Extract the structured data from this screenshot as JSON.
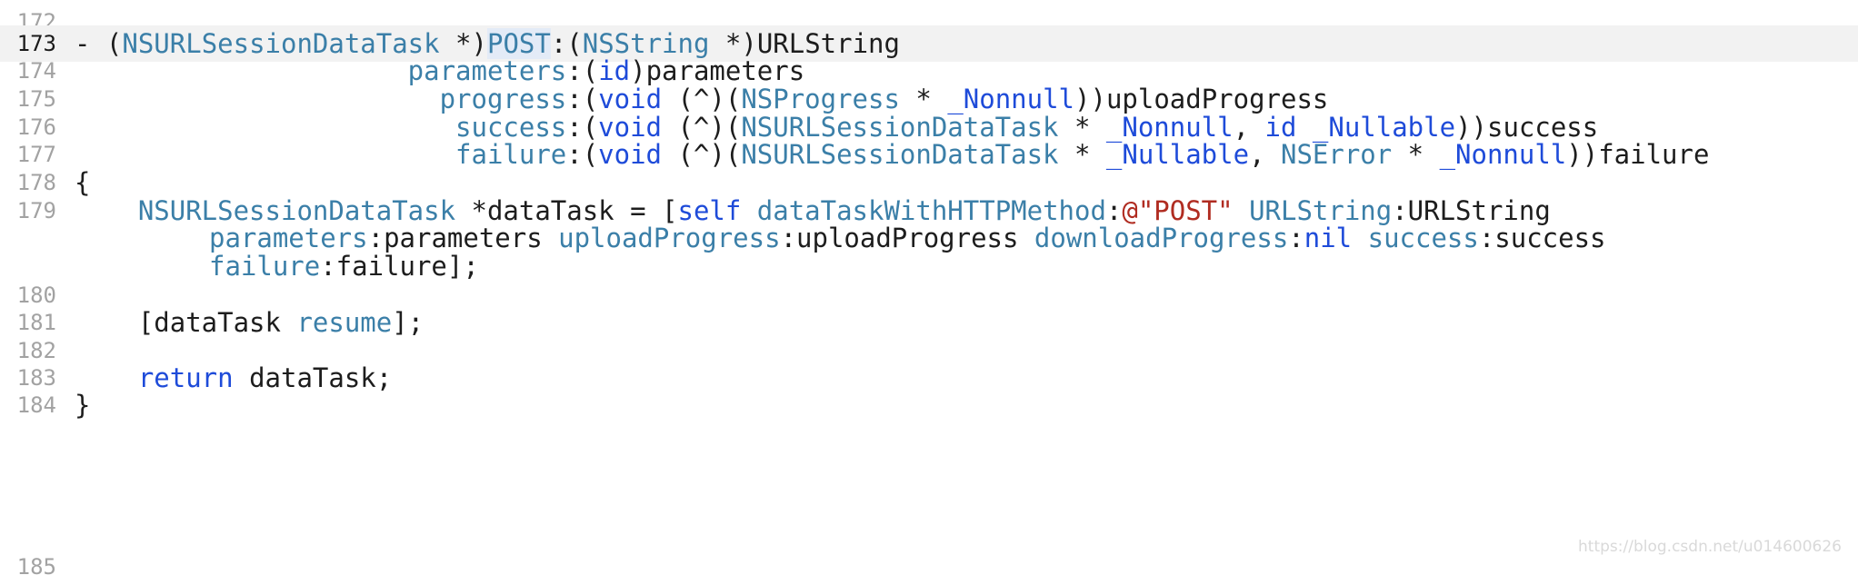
{
  "editor": {
    "line_numbers": [
      "172",
      "173",
      "174",
      "175",
      "176",
      "177",
      "178",
      "179",
      "180",
      "181",
      "182",
      "183",
      "184",
      "185"
    ],
    "lines": {
      "l173": {
        "dash": "- (",
        "type1": "NSURLSessionDataTask",
        "star": " *)",
        "method": "POST",
        "colon": ":(",
        "type2": "NSString",
        "rest": " *)URLString"
      },
      "l174": {
        "indent": "                     ",
        "sel": "parameters",
        "open": ":(",
        "kw": "id",
        "rest": ")parameters"
      },
      "l175": {
        "indent": "                       ",
        "sel": "progress",
        "open": ":(",
        "kw": "void",
        "mid": " (^)(",
        "type": "NSProgress",
        "star": " * ",
        "ann": "_Nonnull",
        "rest": "))uploadProgress"
      },
      "l176": {
        "indent": "                        ",
        "sel": "success",
        "open": ":(",
        "kw": "void",
        "mid": " (^)(",
        "type": "NSURLSessionDataTask",
        "star": " * ",
        "ann1": "_Nonnull",
        "comma": ", ",
        "kw2": "id",
        "sp": " ",
        "ann2": "_Nullable",
        "rest": "))success"
      },
      "l177": {
        "indent": "                        ",
        "sel": "failure",
        "open": ":(",
        "kw": "void",
        "mid": " (^)(",
        "type": "NSURLSessionDataTask",
        "star": " * ",
        "ann1": "_Nullable",
        "comma": ", ",
        "type2": "NSError",
        "star2": " * ",
        "ann2": "_Nonnull",
        "rest": "))failure"
      },
      "l178": {
        "text": "{"
      },
      "l179": {
        "indent": "    ",
        "type": "NSURLSessionDataTask",
        "decl": " *dataTask = [",
        "self": "self",
        "sp": " ",
        "sel1": "dataTaskWithHTTPMethod",
        "colon1": ":",
        "str": "@\"POST\"",
        "sp2": " ",
        "sel2": "URLString",
        "rest": ":URLString"
      },
      "l179b": {
        "sel1": "parameters",
        "arg1": ":parameters ",
        "sel2": "uploadProgress",
        "arg2": ":uploadProgress ",
        "sel3": "downloadProgress",
        "colon3": ":",
        "nil": "nil",
        "sp": " ",
        "sel4": "success",
        "arg4": ":success"
      },
      "l179c": {
        "sel": "failure",
        "rest": ":failure];"
      },
      "l181": {
        "indent": "    [dataTask ",
        "sel": "resume",
        "rest": "];"
      },
      "l183": {
        "indent": "    ",
        "kw": "return",
        "rest": " dataTask;"
      },
      "l184": {
        "text": "}"
      }
    }
  },
  "watermark": "https://blog.csdn.net/u014600626"
}
